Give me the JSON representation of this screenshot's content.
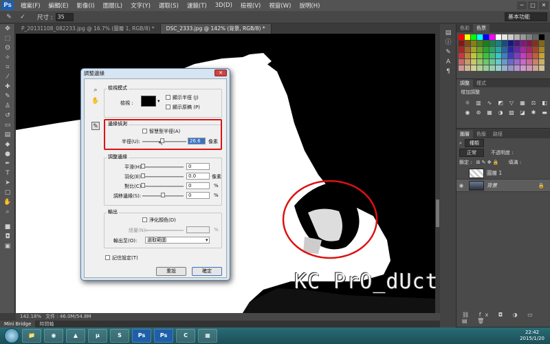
{
  "app": {
    "logo": "Ps"
  },
  "menu": [
    "檔案(F)",
    "編輯(E)",
    "影像(I)",
    "圖層(L)",
    "文字(Y)",
    "選取(S)",
    "濾鏡(T)",
    "3D(D)",
    "檢視(V)",
    "視窗(W)",
    "說明(H)"
  ],
  "window_buttons": [
    "─",
    "□",
    "✕"
  ],
  "options": {
    "size_label": "尺寸 :",
    "size_value": "35",
    "workspace": "基本功能"
  },
  "tabs": [
    {
      "label": "P_20131108_082233.jpg @ 16.7% (圖層 1, RGB/8) *",
      "active": false
    },
    {
      "label": "DSC_2333.jpg @ 142% (背景, RGB/8) *",
      "active": true
    }
  ],
  "status": {
    "zoom": "142.18%",
    "doc": "文件 : 46.0M/54.8M"
  },
  "bridge": [
    "Mini Bridge",
    "時間軸"
  ],
  "panels": {
    "color_tabs": [
      "色彩",
      "色票"
    ],
    "adjust_tabs": [
      "調整",
      "樣式"
    ],
    "adjust_title": "增加調整",
    "layers_tabs": [
      "圖層",
      "色版",
      "路徑"
    ],
    "kind": "種類",
    "blend": "正常",
    "opacity_label": "不透明度 :",
    "lock_label": "鎖定 :",
    "fill_label": "填滿 :",
    "layers": [
      {
        "name": "圖層 1",
        "selected": false
      },
      {
        "name": "背景",
        "selected": true
      }
    ]
  },
  "dialog": {
    "title": "調整邊緣",
    "close": "✕",
    "view_mode": "檢視模式",
    "view_label": "檢視 :",
    "show_radius": "顯示半徑 (J)",
    "show_original": "顯示原稿 (P)",
    "edge_detection": "邊緣偵測",
    "smart_radius": "智慧型半徑(A)",
    "radius_label": "半徑(U):",
    "radius_value": "26.6",
    "pixels": "像素",
    "adjust_edge": "調整邊緣",
    "smooth": "平滑(H):",
    "feather": "羽化(E):",
    "contrast": "對比(C):",
    "shift": "調移邊緣(S):",
    "smooth_value": "0",
    "feather_value": "0.0",
    "contrast_value": "0",
    "shift_value": "0",
    "percent": "%",
    "output": "輸出",
    "decontaminate": "淨化顏色(D)",
    "amount": "總量(N):",
    "output_to_label": "輸出至(O):",
    "output_to_value": "選取範圍",
    "remember": "記住設定(T)",
    "cancel": "重設",
    "ok": "確定"
  },
  "watermark": "KC PrO_dUctiON",
  "taskbar": {
    "apps": [
      "📁",
      "◉",
      "▲",
      "µ",
      "S",
      "Ps",
      "Ps",
      "C",
      "▦"
    ],
    "time": "22:42",
    "date": "2015/1/20"
  },
  "colors": {
    "accent": "#d11",
    "dialog": "#d7e4f1"
  }
}
